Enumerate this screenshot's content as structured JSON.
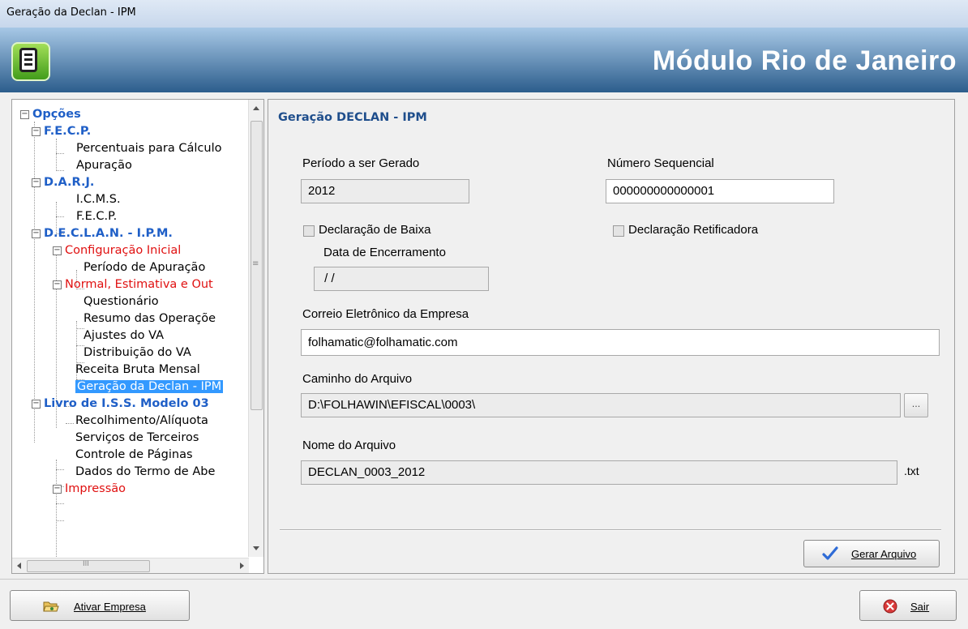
{
  "window": {
    "title": "Geração da Declan - IPM"
  },
  "header": {
    "module_title": "Módulo Rio de Janeiro",
    "logo_icon": "e-document-logo-icon"
  },
  "tree": {
    "nodes": [
      {
        "label": "Opções",
        "style": "blue",
        "expander": "⊟"
      },
      {
        "label": "F.E.C.P.",
        "style": "blue",
        "expander": "⊟"
      },
      {
        "label": "Percentuais para Cálculo",
        "style": "black"
      },
      {
        "label": "Apuração",
        "style": "black"
      },
      {
        "label": "D.A.R.J.",
        "style": "blue",
        "expander": "⊟"
      },
      {
        "label": "I.C.M.S.",
        "style": "black"
      },
      {
        "label": "F.E.C.P.",
        "style": "black"
      },
      {
        "label": "D.E.C.L.A.N. - I.P.M.",
        "style": "blue",
        "expander": "⊟"
      },
      {
        "label": "Configuração Inicial",
        "style": "red",
        "expander": "⊟"
      },
      {
        "label": "Período de Apuração",
        "style": "black"
      },
      {
        "label": "Normal, Estimativa e Out",
        "style": "red",
        "expander": "⊟"
      },
      {
        "label": "Questionário",
        "style": "black"
      },
      {
        "label": "Resumo das Operaçõe",
        "style": "black"
      },
      {
        "label": "Ajustes do VA",
        "style": "black"
      },
      {
        "label": "Distribuição do VA",
        "style": "black"
      },
      {
        "label": "Receita Bruta Mensal",
        "style": "black"
      },
      {
        "label": "Geração da Declan - IPM",
        "style": "selected"
      },
      {
        "label": "Livro de I.S.S. Modelo 03",
        "style": "blue",
        "expander": "⊟"
      },
      {
        "label": "Recolhimento/Alíquota",
        "style": "black"
      },
      {
        "label": "Serviços de Terceiros",
        "style": "black"
      },
      {
        "label": "Controle de Páginas",
        "style": "black"
      },
      {
        "label": "Dados do Termo de Abe",
        "style": "black"
      },
      {
        "label": "Impressão",
        "style": "red",
        "expander": "⊟"
      }
    ],
    "hscroll_grip": "III",
    "vscroll_grip": "≡"
  },
  "form": {
    "section_title": "Geração DECLAN - IPM",
    "periodo_label": "Período a ser Gerado",
    "periodo_value": "2012",
    "numero_label": "Número Sequencial",
    "numero_value": "000000000000001",
    "baixa_label": "Declaração de Baixa",
    "baixa_checked": false,
    "retificadora_label": "Declaração Retificadora",
    "retificadora_checked": false,
    "data_encerramento_label": "Data de Encerramento",
    "data_encerramento_value": " / /",
    "email_label": "Correio Eletrônico da Empresa",
    "email_value": "folhamatic@folhamatic.com",
    "caminho_label": "Caminho do Arquivo",
    "caminho_value": "D:\\FOLHAWIN\\EFISCAL\\0003\\",
    "browse_label": "...",
    "nome_label": "Nome do Arquivo",
    "nome_value": "DECLAN_0003_2012",
    "extension": ".txt",
    "gerar_label": "Gerar Arquivo"
  },
  "footer": {
    "ativar_label": "Ativar Empresa",
    "sair_label": "Sair"
  },
  "colors": {
    "header_dark": "#2c5d8c",
    "tree_blue": "#1f5fc7",
    "tree_red": "#e01010",
    "selection": "#3399ff"
  }
}
